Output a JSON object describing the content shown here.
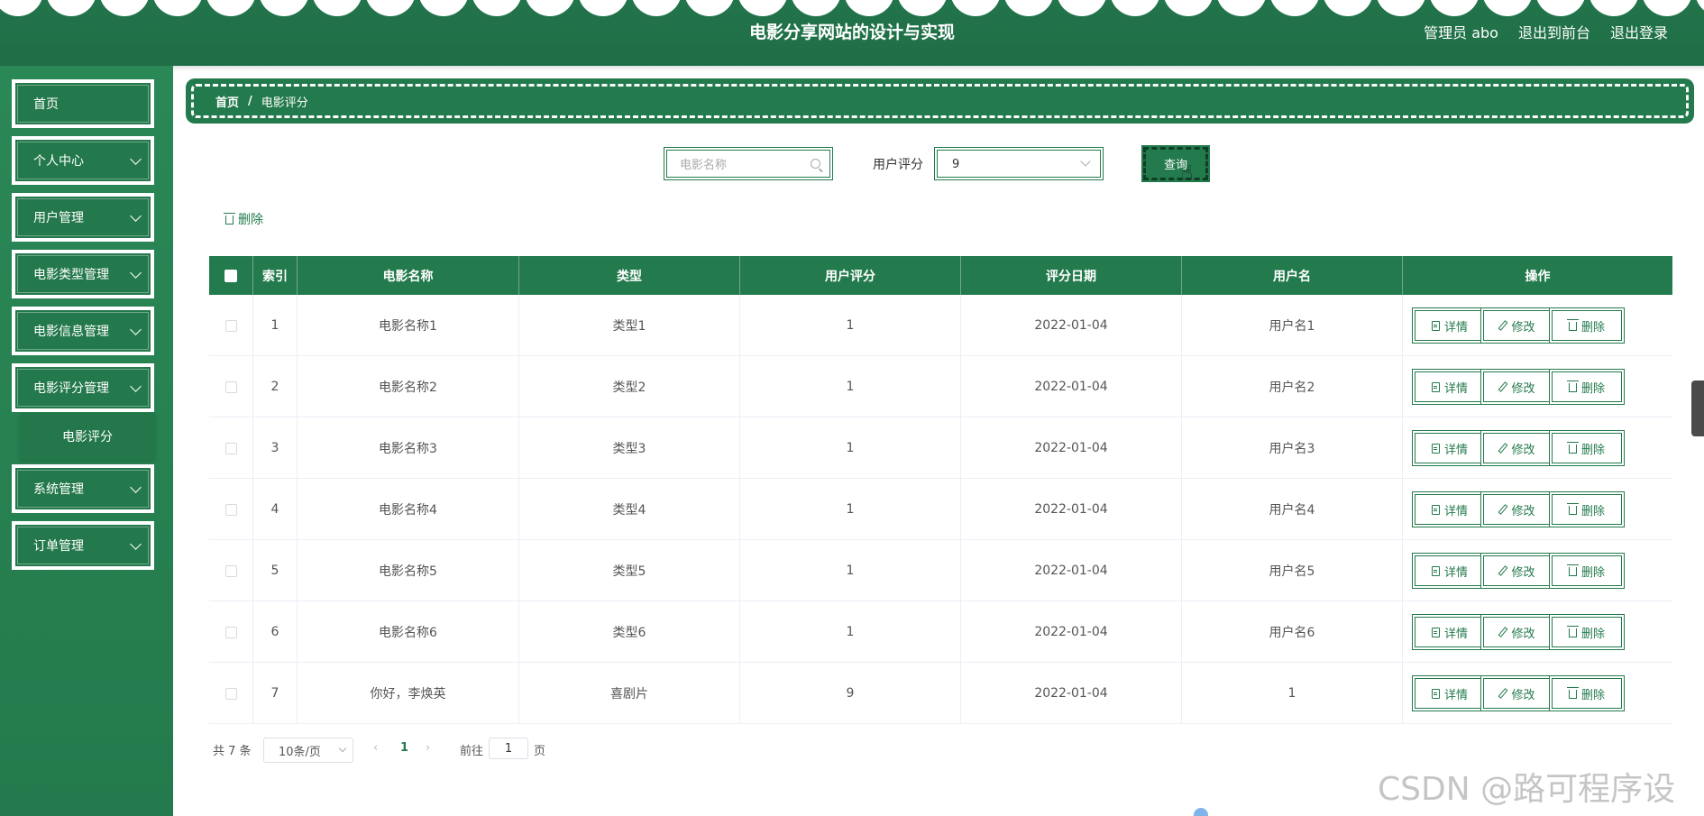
{
  "header": {
    "title": "电影分享网站的设计与实现",
    "user_label": "管理员 abo",
    "to_front": "退出到前台",
    "logout": "退出登录"
  },
  "sidebar": {
    "items": [
      {
        "label": "首页",
        "has_children": false
      },
      {
        "label": "个人中心",
        "has_children": true
      },
      {
        "label": "用户管理",
        "has_children": true
      },
      {
        "label": "电影类型管理",
        "has_children": true
      },
      {
        "label": "电影信息管理",
        "has_children": true
      },
      {
        "label": "电影评分管理",
        "has_children": true
      },
      {
        "label": "系统管理",
        "has_children": true
      },
      {
        "label": "订单管理",
        "has_children": true
      }
    ],
    "active_sub": "电影评分"
  },
  "breadcrumb": {
    "home": "首页",
    "separator": "/",
    "current": "电影评分"
  },
  "search": {
    "name_placeholder": "电影名称",
    "rating_label": "用户评分",
    "rating_value": "9",
    "query_label": "查询"
  },
  "toolbar": {
    "delete_label": "删除"
  },
  "table": {
    "headers": [
      "索引",
      "电影名称",
      "类型",
      "用户评分",
      "评分日期",
      "用户名",
      "操作"
    ],
    "rows": [
      {
        "index": "1",
        "name": "电影名称1",
        "type": "类型1",
        "rating": "1",
        "date": "2022-01-04",
        "user": "用户名1"
      },
      {
        "index": "2",
        "name": "电影名称2",
        "type": "类型2",
        "rating": "1",
        "date": "2022-01-04",
        "user": "用户名2"
      },
      {
        "index": "3",
        "name": "电影名称3",
        "type": "类型3",
        "rating": "1",
        "date": "2022-01-04",
        "user": "用户名3"
      },
      {
        "index": "4",
        "name": "电影名称4",
        "type": "类型4",
        "rating": "1",
        "date": "2022-01-04",
        "user": "用户名4"
      },
      {
        "index": "5",
        "name": "电影名称5",
        "type": "类型5",
        "rating": "1",
        "date": "2022-01-04",
        "user": "用户名5"
      },
      {
        "index": "6",
        "name": "电影名称6",
        "type": "类型6",
        "rating": "1",
        "date": "2022-01-04",
        "user": "用户名6"
      },
      {
        "index": "7",
        "name": "你好，李焕英",
        "type": "喜剧片",
        "rating": "9",
        "date": "2022-01-04",
        "user": "1"
      }
    ],
    "actions": {
      "detail": "详情",
      "edit": "修改",
      "delete": "删除"
    }
  },
  "pagination": {
    "total": "共 7 条",
    "page_size": "10条/页",
    "prev": "‹",
    "current_page": "1",
    "next": "›",
    "goto_label": "前往",
    "goto_value": "1",
    "unit": "页"
  },
  "watermark": "CSDN @路可程序设计",
  "colors": {
    "primary": "#237a4c",
    "sidebar": "#2a8856",
    "header": "#22744b"
  }
}
